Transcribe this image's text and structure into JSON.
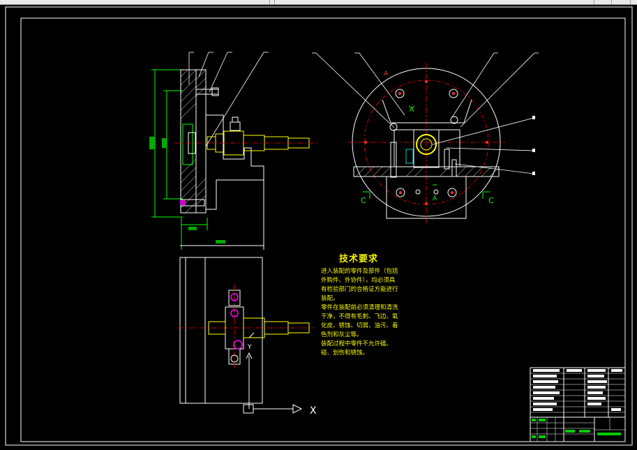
{
  "window": {
    "ribbon_strip": ""
  },
  "notes": {
    "title": "技术要求",
    "lines": [
      "进入装配的零件及部件（包括",
      "外购件、外协件），均必须具",
      "有检验部门的合格证方能进行",
      "装配。",
      "零件在装配前必须清理和清洗",
      "干净，不得有毛刺、飞边、氧",
      "化皮、锈蚀、切屑、油污、着",
      "色剂和灰尘等。",
      "装配过程中零件不允许磕、",
      "碰、划伤和锈蚀。"
    ]
  },
  "labels": {
    "section_a_top": "A",
    "section_a_mid": "A",
    "section_a_bottom": "A",
    "section_c_left": "C",
    "section_c_right": "C",
    "axis_x": "X",
    "axis_y": "Y"
  },
  "colors": {
    "background": "#000000",
    "frame": "#ffffff",
    "dimension": "#00ff00",
    "centerline": "#ff0000",
    "part": "#ffffff",
    "shaft": "#ffff00",
    "leader": "#ffffff",
    "fastener": "#ff00ff"
  }
}
